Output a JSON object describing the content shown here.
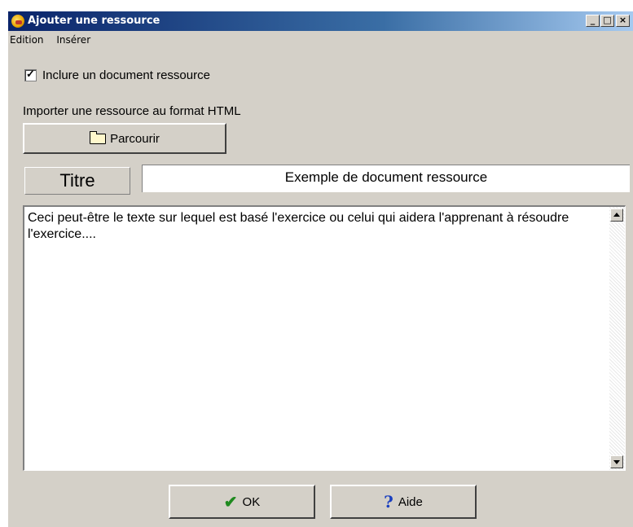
{
  "window": {
    "title": "Ajouter une ressource",
    "controls": {
      "minimize": "_",
      "maximize": "□",
      "close": "×"
    }
  },
  "menubar": {
    "items": [
      "Edition",
      "Insérer"
    ]
  },
  "checkbox": {
    "label": "Inclure un document ressource",
    "checked": true
  },
  "import": {
    "label": "Importer une ressource au format HTML",
    "browse_button": "Parcourir",
    "browse_icon": "folder-open-icon"
  },
  "title_field": {
    "label": "Titre",
    "value": "Exemple de document ressource"
  },
  "body_text": "Ceci peut-être le texte sur lequel est basé l'exercice ou celui qui aidera l'apprenant à résoudre l'exercice....",
  "buttons": {
    "ok": "OK",
    "ok_icon": "checkmark-icon",
    "help": "Aide",
    "help_icon": "question-mark-icon"
  }
}
